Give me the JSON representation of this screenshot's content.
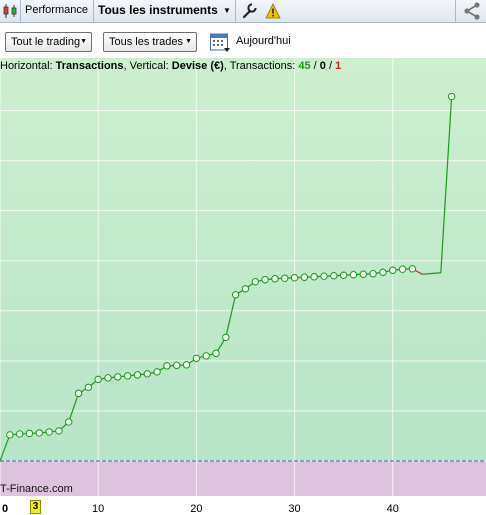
{
  "toolbar": {
    "performance_label": "Performance",
    "instruments_label": "Tous les instruments",
    "icons": [
      "candlestick-icon",
      "wrench-icon",
      "warning-icon",
      "share-icon"
    ]
  },
  "filters": {
    "trading_period": "Tout le trading",
    "trade_type": "Tous les trades",
    "today_label": "Aujourd'hui"
  },
  "chart_info": {
    "horizontal_prefix": "Horizontal: ",
    "horizontal_value": "Transactions",
    "vertical_prefix": ", Vertical: ",
    "vertical_value": "Devise (€)",
    "transactions_prefix": ", Transactions: ",
    "count_green": "45",
    "sep1": " / ",
    "count_neutral": "0",
    "sep2": " / ",
    "count_red": "1"
  },
  "watermark": "T-Finance.com",
  "current_trade_marker": "3",
  "colors": {
    "profit_fill_top": "#cdefcf",
    "profit_fill_bottom": "#b8e4c8",
    "loss_fill": "#ddc3dd",
    "gain_line": "#1a9a1a",
    "loss_line": "#c81e1e",
    "zero_line": "#4a5bd0"
  },
  "chart_data": {
    "type": "line",
    "xlabel": "Transactions",
    "ylabel": "Devise (€)",
    "x_ticks": [
      0,
      10,
      20,
      30,
      40
    ],
    "x_range": [
      0,
      49.5
    ],
    "grid": true,
    "y_grid_levels": [
      0,
      1,
      2,
      3,
      4,
      5,
      6,
      7
    ],
    "y_range": [
      -0.7,
      8.05
    ],
    "series": [
      {
        "values": [
          [
            0,
            0
          ],
          [
            1,
            0.52
          ],
          [
            2,
            0.54
          ],
          [
            3,
            0.55
          ],
          [
            4,
            0.56
          ],
          [
            5,
            0.58
          ],
          [
            6,
            0.6
          ],
          [
            7,
            0.78
          ],
          [
            8,
            1.35
          ],
          [
            9,
            1.47
          ],
          [
            10,
            1.63
          ],
          [
            11,
            1.66
          ],
          [
            12,
            1.68
          ],
          [
            13,
            1.7
          ],
          [
            14,
            1.72
          ],
          [
            15,
            1.74
          ],
          [
            16,
            1.78
          ],
          [
            17,
            1.9
          ],
          [
            18,
            1.91
          ],
          [
            19,
            1.92
          ],
          [
            20,
            2.05
          ],
          [
            21,
            2.1
          ],
          [
            22,
            2.15
          ],
          [
            23,
            2.47
          ],
          [
            24,
            3.32
          ],
          [
            25,
            3.44
          ],
          [
            26,
            3.58
          ],
          [
            27,
            3.62
          ],
          [
            28,
            3.64
          ],
          [
            29,
            3.65
          ],
          [
            30,
            3.66
          ],
          [
            31,
            3.67
          ],
          [
            32,
            3.68
          ],
          [
            33,
            3.69
          ],
          [
            34,
            3.7
          ],
          [
            35,
            3.71
          ],
          [
            36,
            3.72
          ],
          [
            37,
            3.73
          ],
          [
            38,
            3.74
          ],
          [
            39,
            3.77
          ],
          [
            40,
            3.81
          ],
          [
            41,
            3.83
          ],
          [
            42,
            3.84
          ],
          [
            43,
            3.73
          ],
          [
            44.9,
            3.76
          ],
          [
            46,
            7.28
          ]
        ],
        "losing_segments": [
          [
            42,
            43
          ]
        ],
        "unmarked_points": [
          0,
          43,
          44.9
        ]
      }
    ]
  }
}
